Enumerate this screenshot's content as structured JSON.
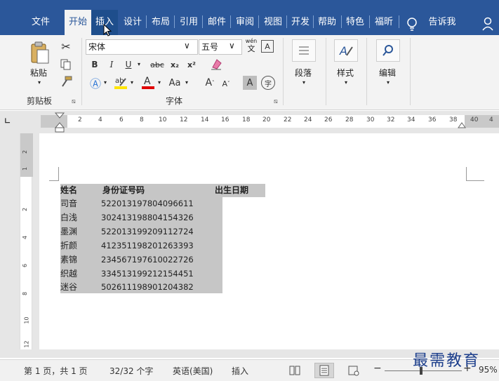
{
  "ribbon_tabs": [
    {
      "label": "文件",
      "state": "normal"
    },
    {
      "label": "开始",
      "state": "active"
    },
    {
      "label": "插入",
      "state": "hover"
    },
    {
      "label": "设计",
      "state": "normal"
    },
    {
      "label": "布局",
      "state": "normal"
    },
    {
      "label": "引用",
      "state": "normal"
    },
    {
      "label": "邮件",
      "state": "normal"
    },
    {
      "label": "审阅",
      "state": "normal"
    },
    {
      "label": "视图",
      "state": "normal"
    },
    {
      "label": "开发",
      "state": "normal"
    },
    {
      "label": "帮助",
      "state": "normal"
    },
    {
      "label": "特色",
      "state": "normal"
    },
    {
      "label": "福昕",
      "state": "normal"
    }
  ],
  "tell_me": "告诉我",
  "clipboard": {
    "paste_label": "粘贴",
    "group_label": "剪贴板"
  },
  "font": {
    "name": "宋体",
    "size": "五号",
    "group_label": "字体",
    "bold": "B",
    "italic": "I",
    "underline": "U",
    "strike": "abc",
    "sub": "x₂",
    "sup": "x²",
    "case": "Aa",
    "grow": "A",
    "shrink": "A",
    "shade": "A",
    "phonetic": "wén",
    "phonetic_char": "文",
    "enclose": "字"
  },
  "paragraph": {
    "label": "段落"
  },
  "styles": {
    "label": "样式"
  },
  "editing": {
    "label": "编辑"
  },
  "ruler": {
    "marks": [
      "2",
      "4",
      "6",
      "8",
      "10",
      "12",
      "14",
      "16",
      "18",
      "20",
      "22",
      "24",
      "26",
      "28",
      "30",
      "32",
      "34",
      "36",
      "38",
      "40",
      "4"
    ]
  },
  "vruler": {
    "marks": [
      "2",
      "1",
      "2",
      "4",
      "6",
      "8",
      "10",
      "12"
    ]
  },
  "table": {
    "headers": [
      "姓名",
      "身份证号码",
      "出生日期"
    ],
    "rows": [
      [
        "司音",
        "522013197804096611"
      ],
      [
        "白浅",
        "302413198804154326"
      ],
      [
        "墨渊",
        "522013199209112724"
      ],
      [
        "折颜",
        "412351198201263393"
      ],
      [
        "素锦",
        "234567197610022726"
      ],
      [
        "织越",
        "334513199212154451"
      ],
      [
        "迷谷",
        "502611198901204382"
      ]
    ]
  },
  "status": {
    "page": "第 1 页，共 1 页",
    "words": "32/32 个字",
    "lang": "英语(美国)",
    "mode": "插入",
    "zoom": "95%"
  },
  "watermark": "最需教育",
  "colors": {
    "ribbon_blue": "#2b579a",
    "highlight_yellow": "#ffe500",
    "font_red": "#e00000",
    "selection_gray": "#c6c6c6"
  }
}
